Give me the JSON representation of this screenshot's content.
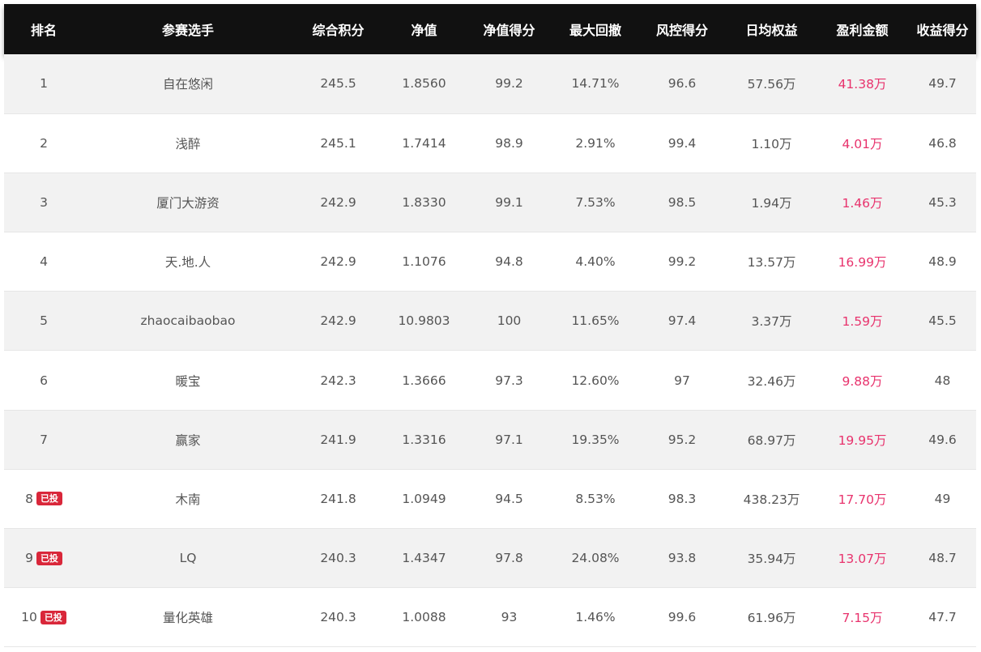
{
  "table": {
    "headers": [
      "排名",
      "参赛选手",
      "综合积分",
      "净值",
      "净值得分",
      "最大回撤",
      "风控得分",
      "日均权益",
      "盈利金额",
      "收益得分"
    ],
    "colors": {
      "header_bg": "#111111",
      "header_text": "#ffffff",
      "profit_text": "#e8336d",
      "badge_bg": "#d9273a",
      "row_alt_bg": "#f2f2f2"
    },
    "rows": [
      {
        "rank": "1",
        "badge": "",
        "name": "自在悠闲",
        "score": "245.5",
        "nav": "1.8560",
        "nav_score": "99.2",
        "max_dd": "14.71%",
        "risk_score": "96.6",
        "avg_equity": "57.56万",
        "profit": "41.38万",
        "return_score": "49.7"
      },
      {
        "rank": "2",
        "badge": "",
        "name": "浅醉",
        "score": "245.1",
        "nav": "1.7414",
        "nav_score": "98.9",
        "max_dd": "2.91%",
        "risk_score": "99.4",
        "avg_equity": "1.10万",
        "profit": "4.01万",
        "return_score": "46.8"
      },
      {
        "rank": "3",
        "badge": "",
        "name": "厦门大游资",
        "score": "242.9",
        "nav": "1.8330",
        "nav_score": "99.1",
        "max_dd": "7.53%",
        "risk_score": "98.5",
        "avg_equity": "1.94万",
        "profit": "1.46万",
        "return_score": "45.3"
      },
      {
        "rank": "4",
        "badge": "",
        "name": "天.地.人",
        "score": "242.9",
        "nav": "1.1076",
        "nav_score": "94.8",
        "max_dd": "4.40%",
        "risk_score": "99.2",
        "avg_equity": "13.57万",
        "profit": "16.99万",
        "return_score": "48.9"
      },
      {
        "rank": "5",
        "badge": "",
        "name": "zhaocaibaobao",
        "score": "242.9",
        "nav": "10.9803",
        "nav_score": "100",
        "max_dd": "11.65%",
        "risk_score": "97.4",
        "avg_equity": "3.37万",
        "profit": "1.59万",
        "return_score": "45.5"
      },
      {
        "rank": "6",
        "badge": "",
        "name": "暖宝",
        "score": "242.3",
        "nav": "1.3666",
        "nav_score": "97.3",
        "max_dd": "12.60%",
        "risk_score": "97",
        "avg_equity": "32.46万",
        "profit": "9.88万",
        "return_score": "48"
      },
      {
        "rank": "7",
        "badge": "",
        "name": "赢家",
        "score": "241.9",
        "nav": "1.3316",
        "nav_score": "97.1",
        "max_dd": "19.35%",
        "risk_score": "95.2",
        "avg_equity": "68.97万",
        "profit": "19.95万",
        "return_score": "49.6"
      },
      {
        "rank": "8",
        "badge": "已投",
        "name": "木南",
        "score": "241.8",
        "nav": "1.0949",
        "nav_score": "94.5",
        "max_dd": "8.53%",
        "risk_score": "98.3",
        "avg_equity": "438.23万",
        "profit": "17.70万",
        "return_score": "49"
      },
      {
        "rank": "9",
        "badge": "已投",
        "name": "LQ",
        "score": "240.3",
        "nav": "1.4347",
        "nav_score": "97.8",
        "max_dd": "24.08%",
        "risk_score": "93.8",
        "avg_equity": "35.94万",
        "profit": "13.07万",
        "return_score": "48.7"
      },
      {
        "rank": "10",
        "badge": "已投",
        "name": "量化英雄",
        "score": "240.3",
        "nav": "1.0088",
        "nav_score": "93",
        "max_dd": "1.46%",
        "risk_score": "99.6",
        "avg_equity": "61.96万",
        "profit": "7.15万",
        "return_score": "47.7"
      }
    ]
  }
}
